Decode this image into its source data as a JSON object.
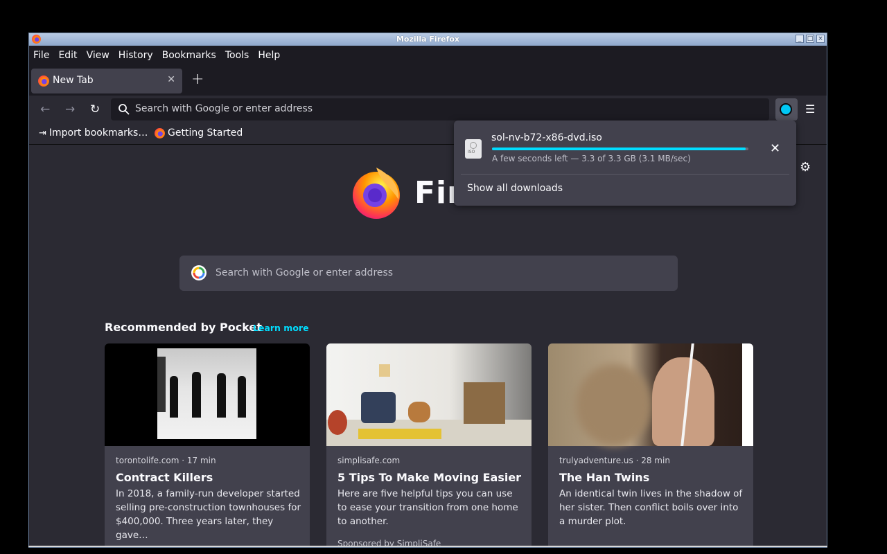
{
  "window": {
    "title": "Mozilla Firefox"
  },
  "menubar": {
    "items": [
      "File",
      "Edit",
      "View",
      "History",
      "Bookmarks",
      "Tools",
      "Help"
    ]
  },
  "tabs": [
    {
      "label": "New Tab"
    }
  ],
  "urlbar": {
    "placeholder": "Search with Google or enter address"
  },
  "bookmarks": [
    {
      "label": "Import bookmarks…",
      "icon": "import-icon"
    },
    {
      "label": "Getting Started",
      "icon": "firefox-icon"
    }
  ],
  "newtab": {
    "wordmark": "Firefox",
    "search_placeholder": "Search with Google or enter address",
    "pocket_title": "Recommended by Pocket",
    "learn_more": "Learn more",
    "cards": [
      {
        "source": "torontolife.com · 17 min",
        "title": "Contract Killers",
        "excerpt": "In 2018, a family-run developer started selling pre-construction townhouses for $400,000. Three years later, they gave…",
        "sponsor": ""
      },
      {
        "source": "simplisafe.com",
        "title": "5 Tips To Make Moving Easier",
        "excerpt": "Here are five helpful tips you can use to ease your transition from one home to another.",
        "sponsor": "Sponsored by SimpliSafe"
      },
      {
        "source": "trulyadventure.us · 28 min",
        "title": "The Han Twins",
        "excerpt": "An identical twin lives in the shadow of her sister. Then conflict boils over into a murder plot.",
        "sponsor": ""
      }
    ]
  },
  "downloads": {
    "filename": "sol-nv-b72-x86-dvd.iso",
    "file_badge": "ISO",
    "progress": 0.99,
    "status": "A few seconds left — 3.3 of 3.3 GB (3.1 MB/sec)",
    "show_all": "Show all downloads"
  },
  "colors": {
    "accent": "#00ddff",
    "toolbar": "#2b2a33",
    "panel": "#42414d"
  }
}
